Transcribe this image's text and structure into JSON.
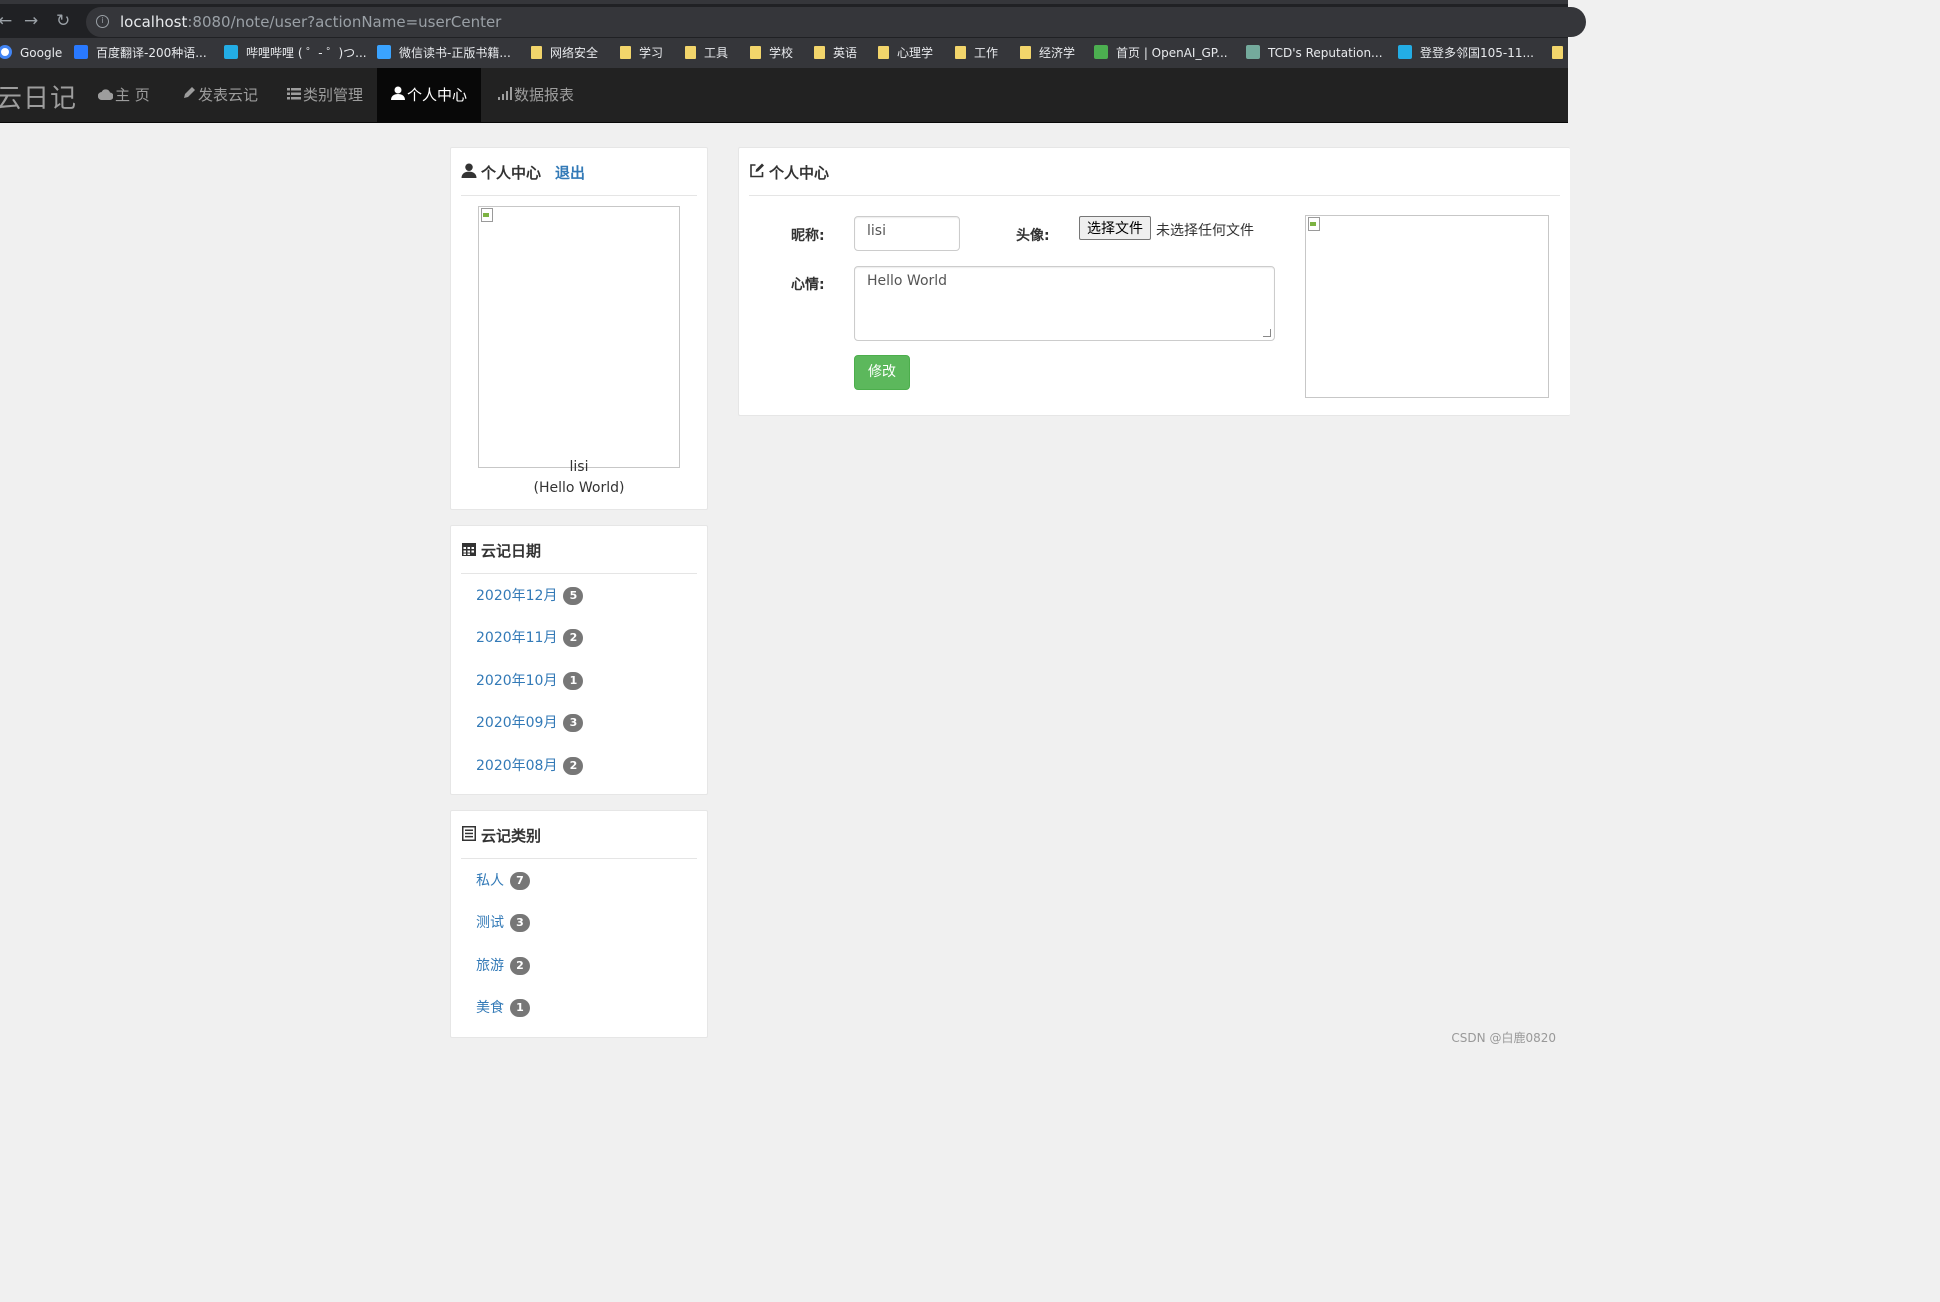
{
  "browser": {
    "url_host": "localhost",
    "url_rest": ":8080/note/user?actionName=userCenter",
    "bookmarks": [
      {
        "label": "Google",
        "icon": "google-icon",
        "color": "#4285f4"
      },
      {
        "label": "百度翻译-200种语...",
        "icon": "translate-icon",
        "color": "#2979ff"
      },
      {
        "label": "哔哩哔哩 ( ゜- ゜)つ...",
        "icon": "bilibili-icon",
        "color": "#23ade5"
      },
      {
        "label": "微信读书-正版书籍...",
        "icon": "weread-icon",
        "color": "#3aa3ff"
      },
      {
        "label": "网络安全",
        "icon": "folder-icon"
      },
      {
        "label": "学习",
        "icon": "folder-icon"
      },
      {
        "label": "工具",
        "icon": "folder-icon"
      },
      {
        "label": "学校",
        "icon": "folder-icon"
      },
      {
        "label": "英语",
        "icon": "folder-icon"
      },
      {
        "label": "心理学",
        "icon": "folder-icon"
      },
      {
        "label": "工作",
        "icon": "folder-icon"
      },
      {
        "label": "经济学",
        "icon": "folder-icon"
      },
      {
        "label": "首页 | OpenAI_GP...",
        "icon": "watermelon-icon",
        "color": "#4caf50"
      },
      {
        "label": "TCD's Reputation...",
        "icon": "chatgpt-icon",
        "color": "#74aa9c"
      },
      {
        "label": "登登多邻国105-11...",
        "icon": "bilibili-icon",
        "color": "#23ade5"
      }
    ]
  },
  "navbar": {
    "brand": "云日记",
    "items": [
      {
        "label": "主 页",
        "icon": "cloud-icon",
        "active": false
      },
      {
        "label": "发表云记",
        "icon": "pencil-icon",
        "active": false
      },
      {
        "label": "类别管理",
        "icon": "list-icon",
        "active": false
      },
      {
        "label": "个人中心",
        "icon": "user-icon",
        "active": true
      },
      {
        "label": "数据报表",
        "icon": "signal-icon",
        "active": false
      }
    ]
  },
  "profile_panel": {
    "title": "个人中心",
    "logout": "退出",
    "nickname": "lisi",
    "mood": "(Hello World)"
  },
  "dates_panel": {
    "title": "云记日期",
    "items": [
      {
        "label": "2020年12月",
        "count": "5"
      },
      {
        "label": "2020年11月",
        "count": "2"
      },
      {
        "label": "2020年10月",
        "count": "1"
      },
      {
        "label": "2020年09月",
        "count": "3"
      },
      {
        "label": "2020年08月",
        "count": "2"
      }
    ]
  },
  "types_panel": {
    "title": "云记类别",
    "items": [
      {
        "label": "私人",
        "count": "7"
      },
      {
        "label": "测试",
        "count": "3"
      },
      {
        "label": "旅游",
        "count": "2"
      },
      {
        "label": "美食",
        "count": "1"
      }
    ]
  },
  "form_panel": {
    "title": "个人中心",
    "nickname_label": "昵称:",
    "nickname_value": "lisi",
    "avatar_label": "头像:",
    "file_button": "选择文件",
    "file_status": "未选择任何文件",
    "mood_label": "心情:",
    "mood_value": "Hello World",
    "submit": "修改"
  },
  "watermark": "CSDN @白鹿0820"
}
